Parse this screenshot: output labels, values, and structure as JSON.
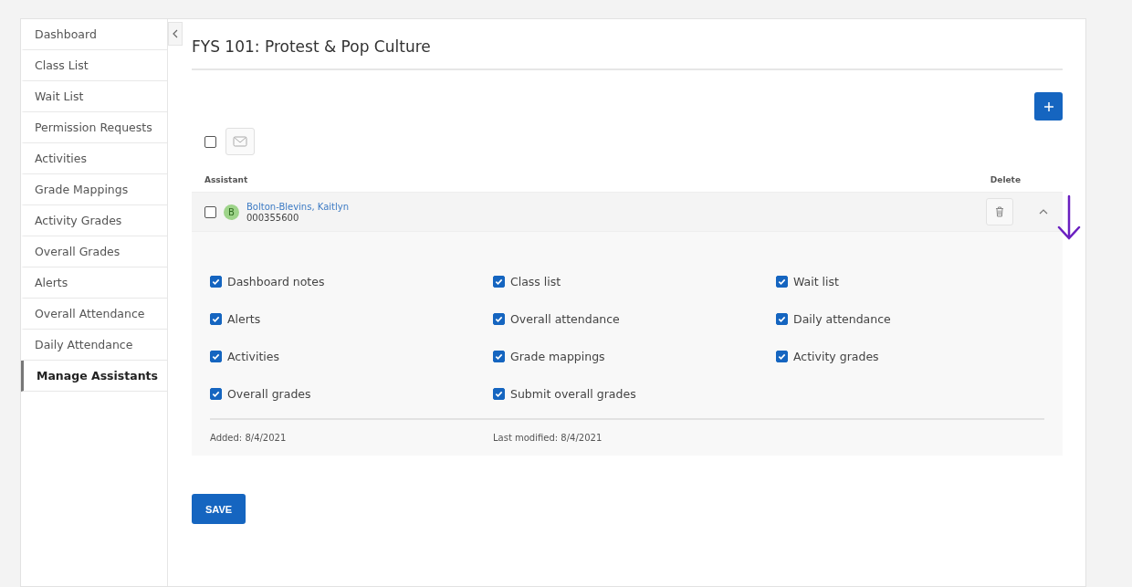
{
  "sidebar": {
    "items": [
      {
        "label": "Dashboard",
        "selected": false
      },
      {
        "label": "Class List",
        "selected": false
      },
      {
        "label": "Wait List",
        "selected": false
      },
      {
        "label": "Permission Requests",
        "selected": false
      },
      {
        "label": "Activities",
        "selected": false
      },
      {
        "label": "Grade Mappings",
        "selected": false
      },
      {
        "label": "Activity Grades",
        "selected": false
      },
      {
        "label": "Overall Grades",
        "selected": false
      },
      {
        "label": "Alerts",
        "selected": false
      },
      {
        "label": "Overall Attendance",
        "selected": false
      },
      {
        "label": "Daily Attendance",
        "selected": false
      },
      {
        "label": "Manage Assistants",
        "selected": true
      }
    ]
  },
  "title": "FYS 101: Protest & Pop Culture",
  "toolbar": {
    "select_all_checked": false
  },
  "table": {
    "columns": [
      "Assistant",
      "Delete"
    ],
    "rows": [
      {
        "checked": false,
        "initial": "B",
        "name": "Bolton-Blevins, Kaitlyn",
        "id": "000355600",
        "expanded": true,
        "permissions": [
          {
            "label": "Dashboard notes",
            "checked": true
          },
          {
            "label": "Class list",
            "checked": true
          },
          {
            "label": "Wait list",
            "checked": true
          },
          {
            "label": "Alerts",
            "checked": true
          },
          {
            "label": "Overall attendance",
            "checked": true
          },
          {
            "label": "Daily attendance",
            "checked": true
          },
          {
            "label": "Activities",
            "checked": true
          },
          {
            "label": "Grade mappings",
            "checked": true
          },
          {
            "label": "Activity grades",
            "checked": true
          },
          {
            "label": "Overall grades",
            "checked": true
          },
          {
            "label": "Submit overall grades",
            "checked": true
          }
        ],
        "added": "Added: 8/4/2021",
        "modified": "Last modified: 8/4/2021"
      }
    ]
  },
  "save_button": "SAVE"
}
